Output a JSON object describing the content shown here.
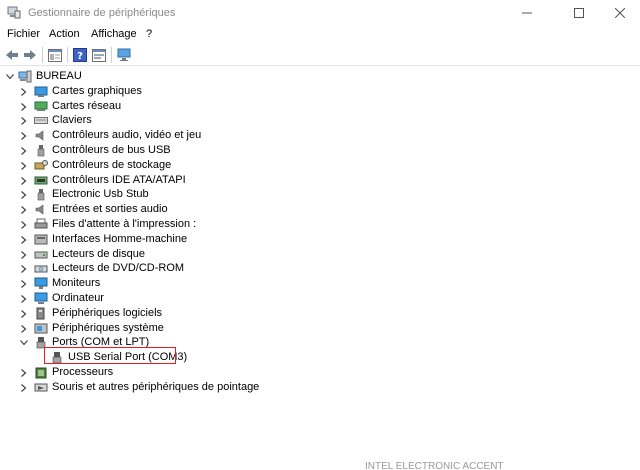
{
  "window": {
    "title": "Gestionnaire de périphériques",
    "icon": "device-manager-icon"
  },
  "menu": [
    "Fichier",
    "Action",
    "Affichage",
    "?"
  ],
  "toolbar": {
    "icons": [
      "back-arrow-icon",
      "forward-arrow-icon",
      "show-hide-tree-icon",
      "help-icon",
      "properties-icon",
      "monitor-scan-icon"
    ]
  },
  "tree": {
    "root": "BUREAU",
    "categories": [
      {
        "label": "Cartes graphiques",
        "icon": "display-adapter-icon"
      },
      {
        "label": "Cartes réseau",
        "icon": "network-adapter-icon"
      },
      {
        "label": "Claviers",
        "icon": "keyboard-icon"
      },
      {
        "label": "Contrôleurs audio, vidéo et jeu",
        "icon": "speaker-icon"
      },
      {
        "label": "Contrôleurs de bus USB",
        "icon": "usb-icon"
      },
      {
        "label": "Contrôleurs de stockage",
        "icon": "storage-controller-icon"
      },
      {
        "label": "Contrôleurs IDE ATA/ATAPI",
        "icon": "ide-controller-icon"
      },
      {
        "label": "Electronic Usb Stub",
        "icon": "usb-icon"
      },
      {
        "label": "Entrées et sorties audio",
        "icon": "speaker-icon"
      },
      {
        "label": "Files d'attente à l'impression :",
        "icon": "printer-icon"
      },
      {
        "label": "Interfaces Homme-machine",
        "icon": "hid-icon"
      },
      {
        "label": "Lecteurs de disque",
        "icon": "disk-drive-icon"
      },
      {
        "label": "Lecteurs de DVD/CD-ROM",
        "icon": "dvd-icon"
      },
      {
        "label": "Moniteurs",
        "icon": "monitor-icon"
      },
      {
        "label": "Ordinateur",
        "icon": "computer-icon"
      },
      {
        "label": "Périphériques logiciels",
        "icon": "software-device-icon"
      },
      {
        "label": "Périphériques système",
        "icon": "system-device-icon"
      },
      {
        "label": "Ports (COM et LPT)",
        "icon": "port-icon",
        "expanded": true,
        "children": [
          {
            "label": "USB Serial Port (COM3)",
            "icon": "port-icon",
            "highlighted": true
          }
        ]
      },
      {
        "label": "Processeurs",
        "icon": "processor-icon"
      },
      {
        "label": "Souris et autres périphériques de pointage",
        "icon": "mouse-icon"
      }
    ]
  },
  "colors": {
    "highlight_border": "#e21d24",
    "title_text": "#8a8a8a"
  }
}
